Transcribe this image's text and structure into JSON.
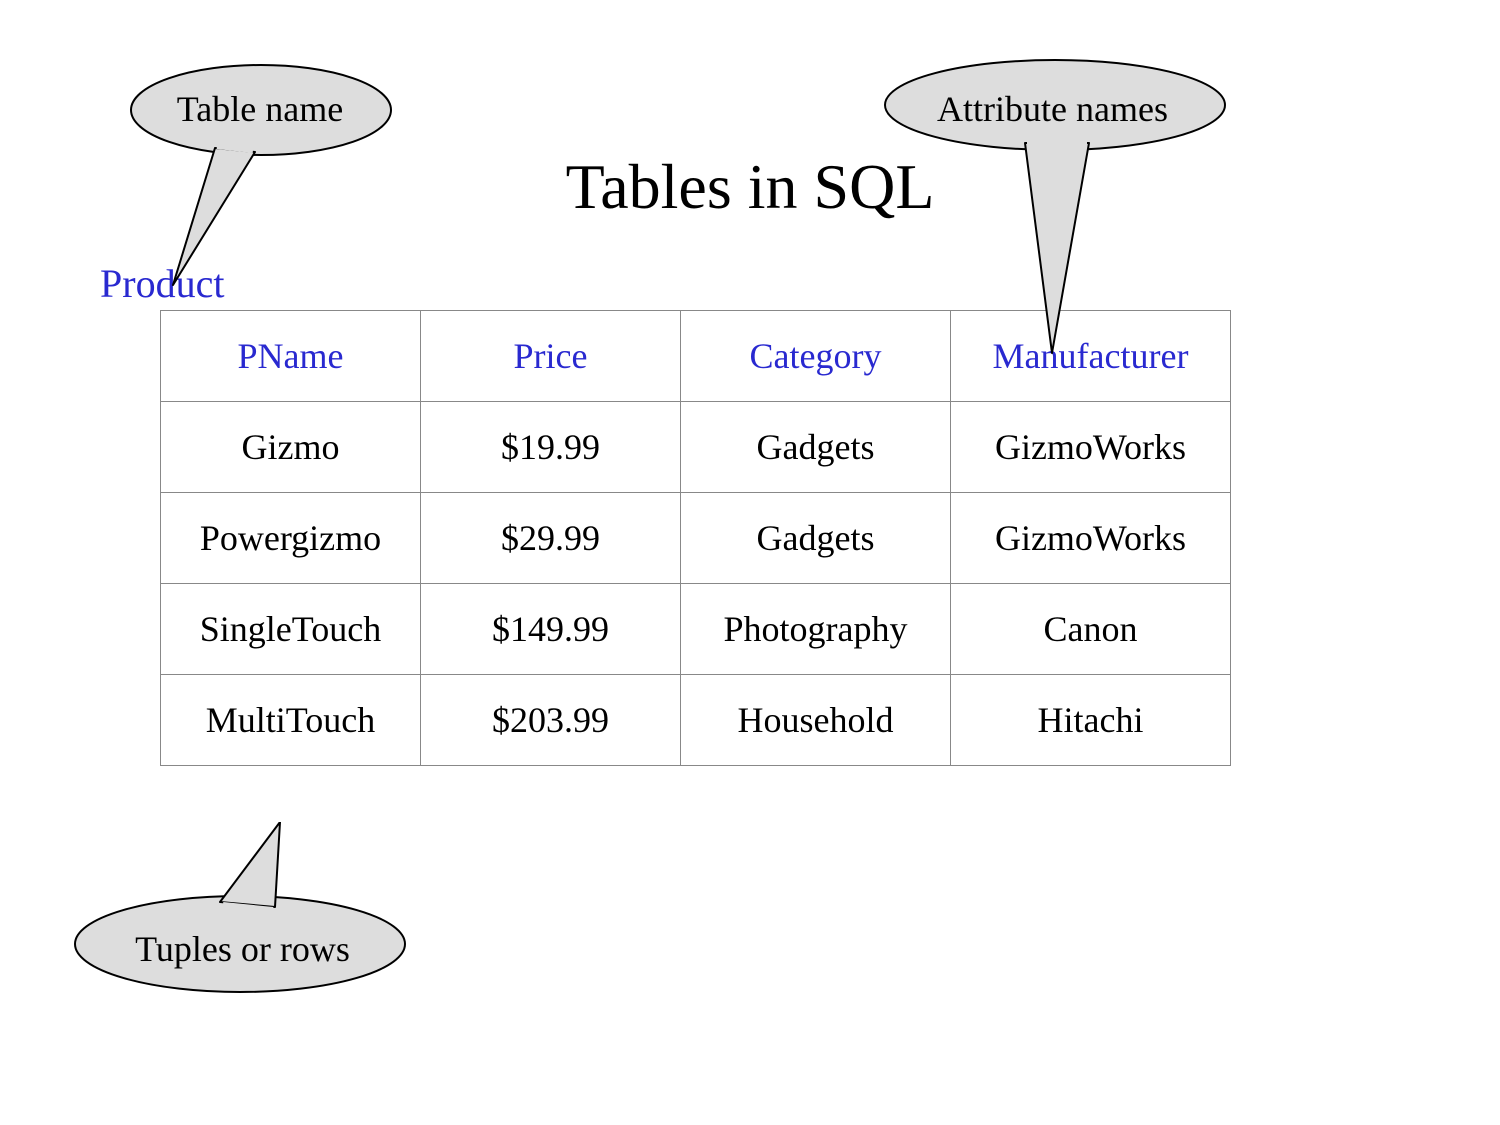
{
  "title": "Tables in SQL",
  "table_name": "Product",
  "callouts": {
    "table_name": "Table name",
    "attribute_names": "Attribute names",
    "tuples": "Tuples or rows"
  },
  "columns": [
    "PName",
    "Price",
    "Category",
    "Manufacturer"
  ],
  "rows": [
    {
      "pname": "Gizmo",
      "price": "$19.99",
      "category": "Gadgets",
      "manufacturer": "GizmoWorks"
    },
    {
      "pname": "Powergizmo",
      "price": "$29.99",
      "category": "Gadgets",
      "manufacturer": "GizmoWorks"
    },
    {
      "pname": "SingleTouch",
      "price": "$149.99",
      "category": "Photography",
      "manufacturer": "Canon"
    },
    {
      "pname": "MultiTouch",
      "price": "$203.99",
      "category": "Household",
      "manufacturer": "Hitachi"
    }
  ],
  "chart_data": {
    "type": "table",
    "title": "Tables in SQL",
    "columns": [
      "PName",
      "Price",
      "Category",
      "Manufacturer"
    ],
    "rows": [
      [
        "Gizmo",
        "$19.99",
        "Gadgets",
        "GizmoWorks"
      ],
      [
        "Powergizmo",
        "$29.99",
        "Gadgets",
        "GizmoWorks"
      ],
      [
        "SingleTouch",
        "$149.99",
        "Photography",
        "Canon"
      ],
      [
        "MultiTouch",
        "$203.99",
        "Household",
        "Hitachi"
      ]
    ]
  },
  "colors": {
    "key": "#2929d0",
    "callout_fill": "#dddddd",
    "callout_stroke": "#000000"
  }
}
